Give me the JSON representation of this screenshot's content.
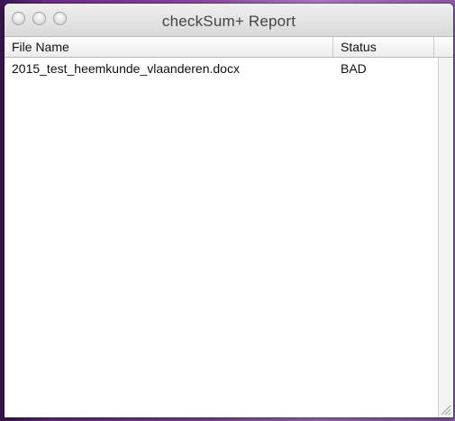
{
  "window": {
    "title": "checkSum+ Report"
  },
  "table": {
    "columns": [
      "File Name",
      "Status"
    ],
    "rows": [
      {
        "file_name": "2015_test_heemkunde_vlaanderen.docx",
        "status": "BAD"
      }
    ]
  },
  "icons": {
    "close": "close-button-icon",
    "minimize": "minimize-button-icon",
    "zoom": "zoom-button-icon",
    "resize": "resize-grip-icon"
  }
}
